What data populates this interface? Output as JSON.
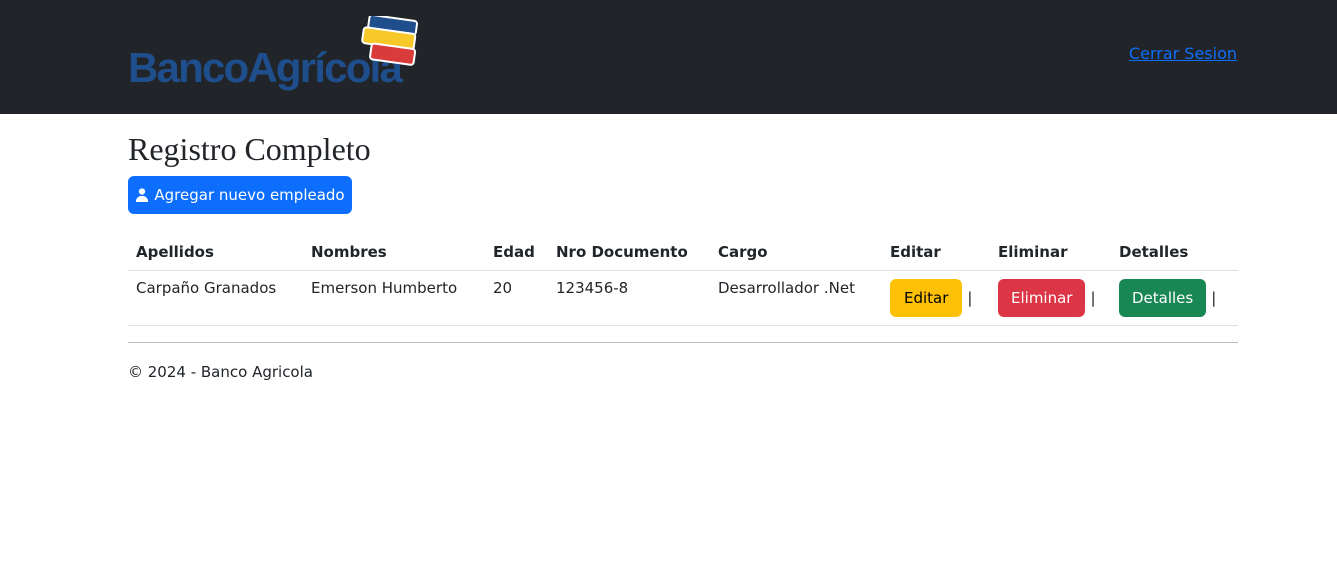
{
  "header": {
    "brand_name": "BancoAgrícola",
    "logout_label": "Cerrar Sesion"
  },
  "main": {
    "title": "Registro Completo",
    "add_button_label": "Agregar nuevo empleado",
    "add_button_icon": "user-icon"
  },
  "table": {
    "headers": [
      "Apellidos",
      "Nombres",
      "Edad",
      "Nro Documento",
      "Cargo",
      "Editar",
      "Eliminar",
      "Detalles"
    ],
    "rows": [
      {
        "apellidos": "Carpaño Granados",
        "nombres": "Emerson Humberto",
        "edad": "20",
        "documento": "123456-8",
        "cargo": "Desarrollador .Net",
        "edit_label": "Editar",
        "delete_label": "Eliminar",
        "details_label": "Detalles",
        "separator": "|"
      }
    ]
  },
  "footer": {
    "text": "© 2024 - Banco Agricola"
  },
  "colors": {
    "navbar": "#212529",
    "primary": "#0d6efd",
    "warning": "#ffc107",
    "danger": "#dc3545",
    "success": "#198754",
    "brand_blue": "#1f4e8c"
  }
}
